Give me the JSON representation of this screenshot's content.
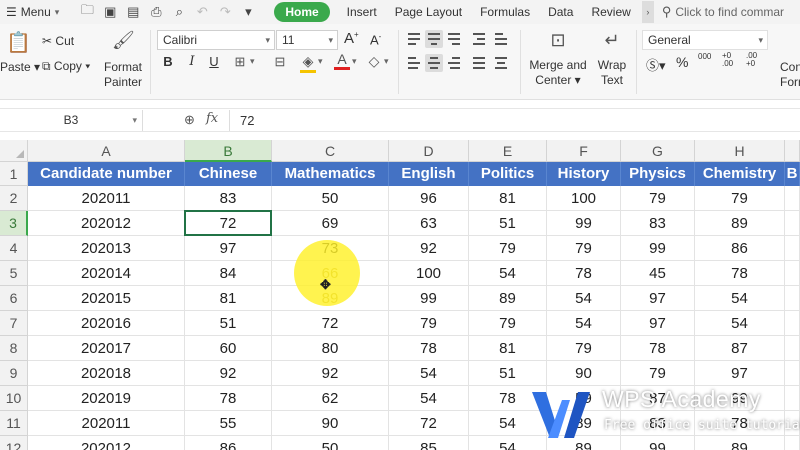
{
  "menubar": {
    "menu_label": "Menu",
    "tabs": [
      "Home",
      "Insert",
      "Page Layout",
      "Formulas",
      "Data",
      "Review"
    ],
    "active_tab": "Home",
    "find_placeholder": "Click to find commar"
  },
  "ribbon": {
    "paste": "Paste",
    "cut": "Cut",
    "copy": "Copy",
    "format_painter_1": "Format",
    "format_painter_2": "Painter",
    "font_name": "Calibri",
    "font_size": "11",
    "merge_1": "Merge and",
    "merge_2": "Center",
    "wrap_1": "Wrap",
    "wrap_2": "Text",
    "number_format": "General",
    "con_1": "Con",
    "con_2": "Forr"
  },
  "formula_bar": {
    "cell_ref": "B3",
    "fx": "fx",
    "value": "72"
  },
  "sheet": {
    "column_letters": [
      "A",
      "B",
      "C",
      "D",
      "E",
      "F",
      "G",
      "H"
    ],
    "selected_column": "B",
    "row_numbers": [
      "1",
      "2",
      "3",
      "4",
      "5",
      "6",
      "7",
      "8",
      "9",
      "10",
      "11",
      "12"
    ],
    "selected_row": "3",
    "headers": [
      "Candidate number",
      "Chinese",
      "Mathematics",
      "English",
      "Politics",
      "History",
      "Physics",
      "Chemistry",
      "B"
    ],
    "rows": [
      [
        "202011",
        "83",
        "50",
        "96",
        "81",
        "100",
        "79",
        "79"
      ],
      [
        "202012",
        "72",
        "69",
        "63",
        "51",
        "99",
        "83",
        "89"
      ],
      [
        "202013",
        "97",
        "73",
        "92",
        "79",
        "79",
        "99",
        "86"
      ],
      [
        "202014",
        "84",
        "66",
        "100",
        "54",
        "78",
        "45",
        "78"
      ],
      [
        "202015",
        "81",
        "89",
        "99",
        "89",
        "54",
        "97",
        "54"
      ],
      [
        "202016",
        "51",
        "72",
        "79",
        "79",
        "54",
        "97",
        "54"
      ],
      [
        "202017",
        "60",
        "80",
        "78",
        "81",
        "79",
        "78",
        "87"
      ],
      [
        "202018",
        "92",
        "92",
        "54",
        "51",
        "90",
        "79",
        "97"
      ],
      [
        "202019",
        "78",
        "62",
        "54",
        "78",
        "59",
        "87",
        "99"
      ],
      [
        "202011",
        "55",
        "90",
        "72",
        "54",
        "89",
        "83",
        "78"
      ],
      [
        "202012",
        "86",
        "50",
        "85",
        "54",
        "89",
        "99",
        "89"
      ]
    ],
    "colors": {
      "header_bg": "#4472c4",
      "selection": "#217346",
      "accent": "#3aa94c"
    }
  },
  "watermark": {
    "title": "WPS Academy",
    "subtitle": "Free office suite tutorials"
  }
}
